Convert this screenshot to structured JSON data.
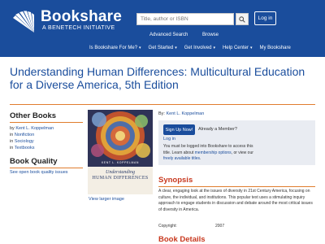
{
  "header": {
    "logo_name": "Bookshare",
    "logo_subtitle": "A BENETECH INITIATIVE",
    "search_placeholder": "Title, author or ISBN",
    "login_label": "Log in",
    "advanced_search": "Advanced Search",
    "browse": "Browse",
    "nav": [
      {
        "label": "Is Bookshare For Me?"
      },
      {
        "label": "Get Started"
      },
      {
        "label": "Get Involved"
      },
      {
        "label": "Help Center"
      },
      {
        "label": "My Bookshare"
      }
    ],
    "colors": {
      "header_bg": "#1a4d9c",
      "accent": "#e07d2e",
      "section_heading": "#c8381e"
    }
  },
  "book": {
    "title": "Understanding Human Differences: Multicultural Education for a Diverse America, 5th Edition",
    "byline_prefix": "By:",
    "author": "Kent L. Koppelman",
    "cover": {
      "author_text": "KENT L. KOPPELMAN",
      "title_line1": "Understanding",
      "title_line2": "HUMAN DIFFERENCES"
    },
    "view_larger": "View larger image"
  },
  "sidebar": {
    "other_books_heading": "Other Books",
    "other_books": [
      {
        "prefix": "by",
        "link": "Kent L. Koppelman"
      },
      {
        "prefix": "in",
        "link": "Nonfiction"
      },
      {
        "prefix": "in",
        "link": "Sociology"
      },
      {
        "prefix": "in",
        "link": "Textbooks"
      }
    ],
    "quality_heading": "Book Quality",
    "quality_link": "See open book quality issues"
  },
  "signup": {
    "button": "Sign Up Now!",
    "member_text": "Already a Member?",
    "login_link": "Log in",
    "access_before": "You must be logged into Bookshare to access this title. Learn about ",
    "membership_link": "membership options",
    "access_middle": ", or view our ",
    "free_titles_link": "freely available titles",
    "access_end": "."
  },
  "synopsis": {
    "heading": "Synopsis",
    "text": "A clear, engaging look at the issues of diversity in 21st Century America, focusing on culture, the individual, and institutions. This popular text uses a stimulating inquiry approach to engage students in discussion and debate around the most critical issues of diversity in America.",
    "copyright_label": "Copyright:",
    "copyright_value": "2007"
  },
  "details": {
    "heading": "Book Details"
  }
}
